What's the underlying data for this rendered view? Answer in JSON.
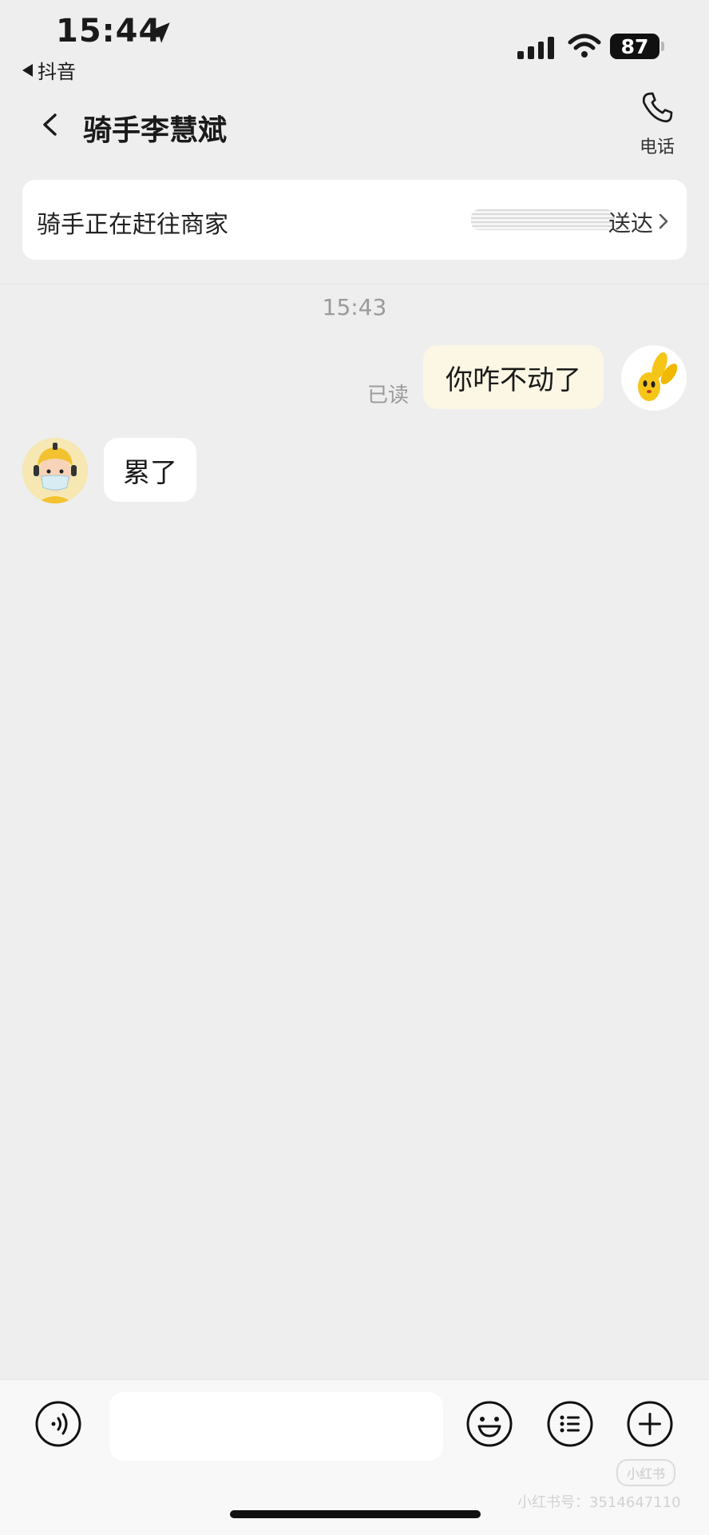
{
  "status_bar": {
    "time": "15:44",
    "back_app_label": "抖音",
    "battery_level": "87",
    "signal_bars": 4,
    "icons": [
      "location-arrow-icon",
      "signal-icon",
      "wifi-icon",
      "battery-icon"
    ]
  },
  "header": {
    "title": "骑手李慧斌",
    "phone_label": "电话",
    "icons": [
      "chevron-left-icon",
      "phone-icon"
    ]
  },
  "status_card": {
    "text": "骑手正在赶往商家",
    "right_text": "送达",
    "icons": [
      "chevron-right-icon"
    ]
  },
  "chat": {
    "timestamp": "15:43",
    "messages": [
      {
        "sender": "me",
        "text": "你咋不动了",
        "read_label": "已读"
      },
      {
        "sender": "rider",
        "text": "累了"
      }
    ]
  },
  "input_bar": {
    "placeholder": "",
    "icons": [
      "voice-icon",
      "emoji-icon",
      "list-menu-icon",
      "plus-icon"
    ]
  },
  "watermark": {
    "logo": "小红书",
    "text": "小红书号：3514647110"
  },
  "colors": {
    "background": "#eeeeee",
    "my_bubble": "#fbf7e4",
    "rider_bubble": "#ffffff",
    "card": "#ffffff"
  }
}
